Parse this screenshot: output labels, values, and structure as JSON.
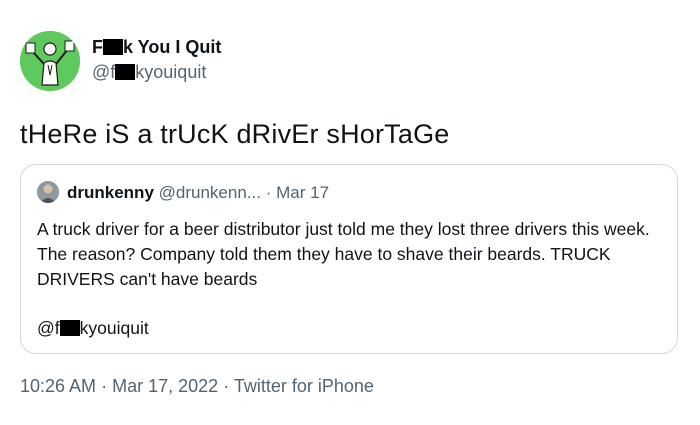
{
  "author": {
    "name_prefix": "F",
    "name_suffix": "k You I Quit",
    "handle_prefix": "@f",
    "handle_suffix": "kyouiquit",
    "avatar_icon": "cartoon-figure-icon",
    "avatar_color": "#5ec95c"
  },
  "tweet": {
    "text": "tHeRe iS a trUcK dRivEr sHorTaGe"
  },
  "quoted": {
    "name": "drunkenny",
    "handle": "@drunkenn...",
    "separator": "·",
    "date": "Mar 17",
    "body": [
      "A truck driver for a beer distributor just told me they lost three drivers this week. The reason? Company told them they have to shave their beards. TRUCK DRIVERS can't have beards"
    ],
    "mention_prefix": "@f",
    "mention_suffix": "kyouiquit",
    "avatar_icon": "profile-photo-icon"
  },
  "footer": {
    "time": "10:26 AM",
    "sep1": "·",
    "date": "Mar 17, 2022",
    "sep2": "·",
    "source": "Twitter for iPhone"
  },
  "colors": {
    "text": "#0f1419",
    "secondary": "#536471",
    "border": "#cfd9de",
    "censor": "#000000"
  }
}
